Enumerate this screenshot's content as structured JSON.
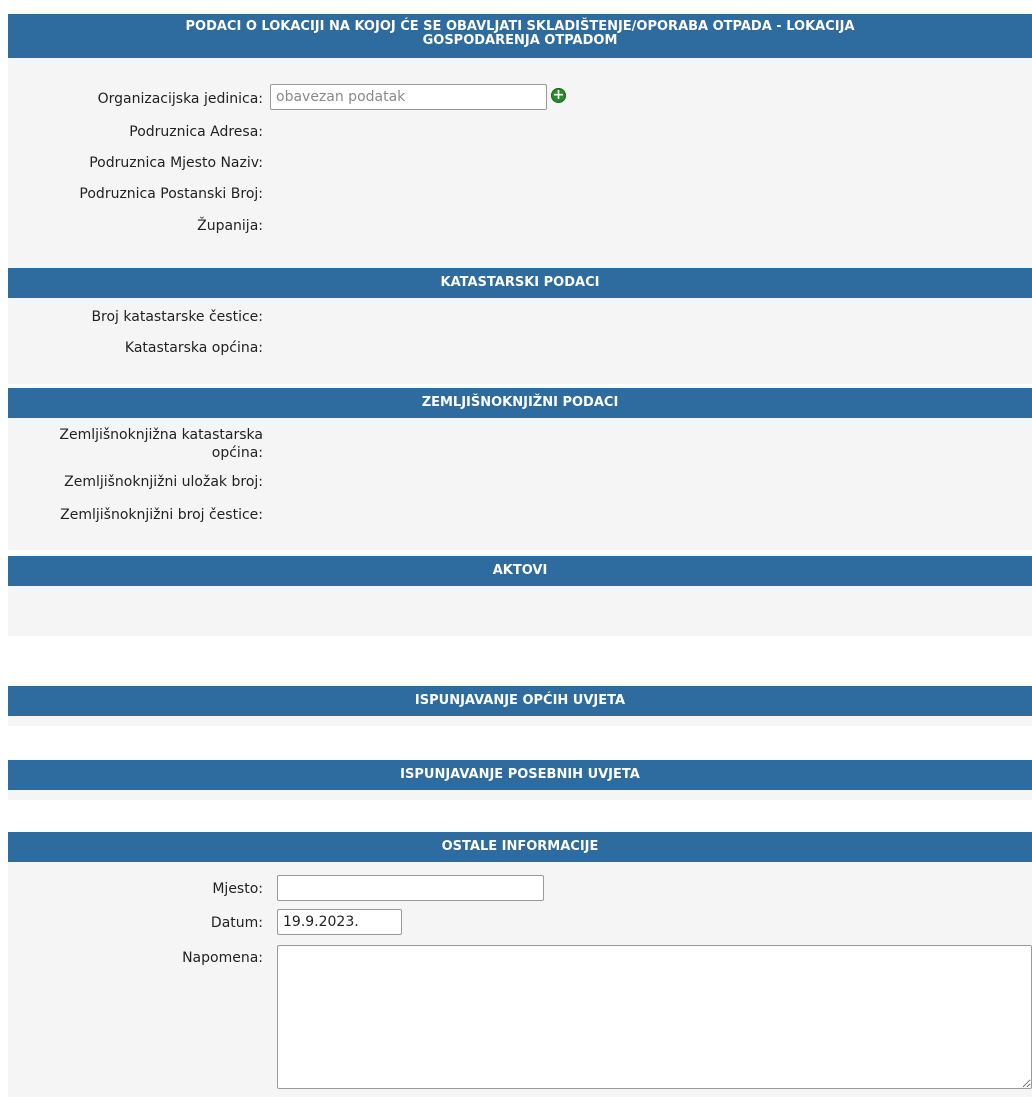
{
  "sections": {
    "lokacija": {
      "title_line1": "PODACI O LOKACIJI NA KOJOJ ĆE SE OBAVLJATI SKLADIŠTENJE/OPORABA OTPADA - LOKACIJA",
      "title_line2": "GOSPODARENJA OTPADOM",
      "org_label": "Organizacijska jedinica:",
      "org_placeholder": "obavezan podatak",
      "adresa_label": "Podruznica Adresa:",
      "mjesto_label": "Podruznica Mjesto Naziv:",
      "postanski_label": "Podruznica Postanski Broj:",
      "zupanija_label": "Županija:"
    },
    "katastar": {
      "title": "KATASTARSKI PODACI",
      "cestica_label": "Broj katastarske čestice:",
      "opcina_label": "Katastarska općina:"
    },
    "zemljisnik": {
      "title": "ZEMLJIŠNOKNJIŽNI PODACI",
      "opcina_label_line1": "Zemljišnoknjižna katastarska",
      "opcina_label_line2": "općina:",
      "ulozak_label": "Zemljišnoknjižni uložak broj:",
      "cestica_label": "Zemljišnoknjižni broj čestice:"
    },
    "aktovi": {
      "title": "AKTOVI"
    },
    "opci_uvjeti": {
      "title": "ISPUNJAVANJE OPĆIH UVJETA"
    },
    "posebni_uvjeti": {
      "title": "ISPUNJAVANJE POSEBNIH UVJETA"
    },
    "ostale": {
      "title": "OSTALE INFORMACIJE",
      "mjesto_label": "Mjesto:",
      "mjesto_value": "",
      "datum_label": "Datum:",
      "datum_value": "19.9.2023.",
      "napomena_label": "Napomena:",
      "napomena_value": ""
    }
  },
  "icons": {
    "add": "plus-circle-icon"
  },
  "colors": {
    "header_bg": "#2e6b9e",
    "panel_bg": "#f5f5f5",
    "add_icon": "#2a8a2a"
  }
}
